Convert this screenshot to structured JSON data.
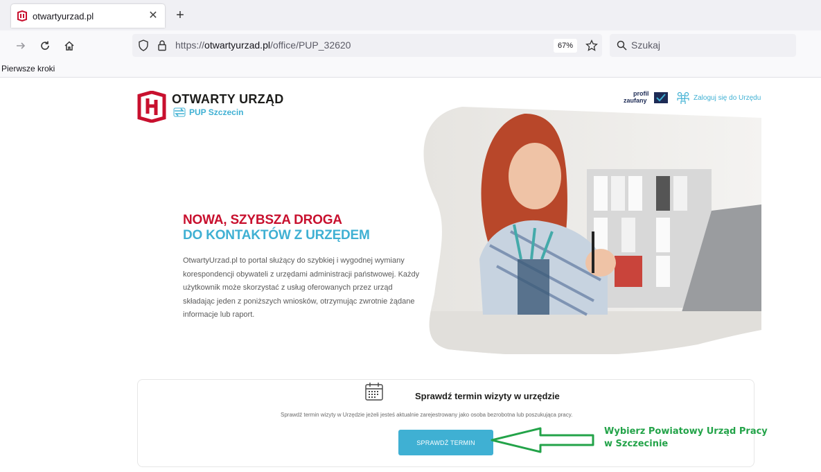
{
  "browser": {
    "tab_title": "otwartyurzad.pl",
    "url_prefix": "https://",
    "url_host": "otwartyurzad.pl",
    "url_path": "/office/PUP_32620",
    "zoom": "67%",
    "search_placeholder": "Szukaj",
    "bookmark": "Pierwsze kroki"
  },
  "header": {
    "brand": "OTWARTY URZĄD",
    "office": "PUP Szczecin",
    "profil_line1": "profil",
    "profil_line2": "zaufany",
    "login": "Zaloguj się do Urzędu"
  },
  "hero": {
    "headline_red": "NOWA, SZYBSZA DROGA",
    "headline_blue": "DO KONTAKTÓW Z URZĘDEM",
    "description": "OtwartyUrzad.pl to portal służący do szybkiej i wygodnej wymiany korespondencji obywateli z urzędami administracji państwowej. Każdy użytkownik może skorzystać z usług oferowanych przez urząd składając jeden z poniższych wniosków, otrzymując zwrotnie żądane informacje lub raport."
  },
  "card": {
    "title": "Sprawdź termin wizyty w urzędzie",
    "description": "Sprawdź termin wizyty w Urzędzie jeżeli jesteś aktualnie zarejestrowany jako osoba bezrobotna lub poszukująca pracy.",
    "button": "SPRAWDŹ TERMIN"
  },
  "annotation": {
    "line1": "Wybierz Powiatowy Urząd Pracy",
    "line2": "w Szczecinie",
    "color": "#23a349"
  },
  "colors": {
    "brand_red": "#c8102e",
    "accent_blue": "#3fb0d3"
  }
}
